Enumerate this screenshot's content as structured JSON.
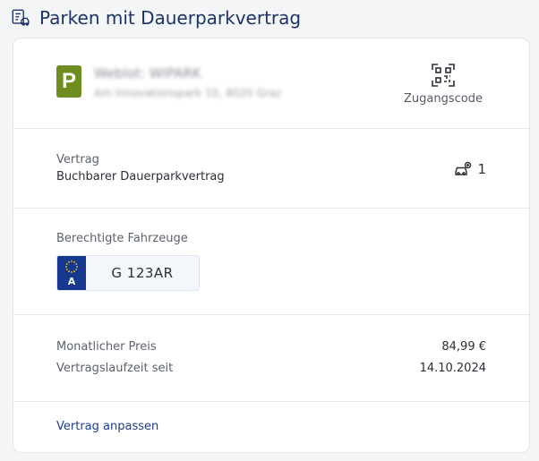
{
  "page": {
    "title": "Parken mit Dauerparkvertrag",
    "header_icon": "parking-contract-icon"
  },
  "location": {
    "logo_letter": "P",
    "logo_color": "#6f8d1e",
    "name": "Weblot: WIPARK",
    "address": "Am Innovationspark 10, 8020 Graz",
    "access_code_label": "Zugangscode",
    "access_code_icon": "qr-code-icon"
  },
  "contract": {
    "label": "Vertrag",
    "value": "Buchbarer Dauerparkvertrag",
    "vehicle_count": "1",
    "vehicle_count_icon": "car-icon"
  },
  "vehicles": {
    "label": "Berechtigte Fahrzeuge",
    "plates": [
      {
        "country": "A",
        "number": "G 123AR"
      }
    ]
  },
  "pricing": {
    "monthly_price_label": "Monatlicher Preis",
    "monthly_price_value": "84,99 €",
    "term_label": "Vertragslaufzeit seit",
    "term_value": "14.10.2024"
  },
  "actions": {
    "adjust_contract": "Vertrag anpassen"
  },
  "colors": {
    "title": "#1c3466",
    "link": "#1c3f8c",
    "eu_blue": "#16398f"
  }
}
